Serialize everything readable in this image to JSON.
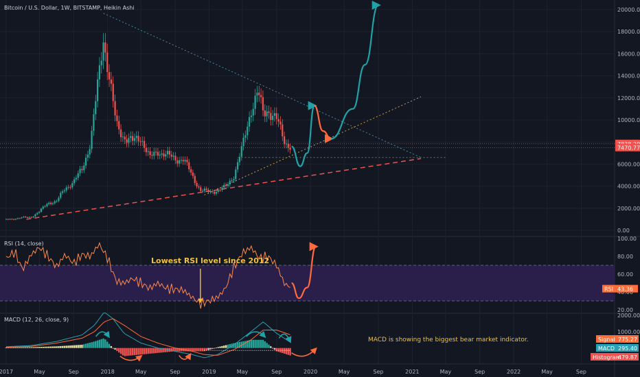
{
  "title": "Bitcoin / U.S. Dollar, 1W, BITSTAMP, Heikin Ashi",
  "colors": {
    "background": "#131722",
    "up": "#26a69a",
    "down": "#ef5350",
    "grid": "#1e2230",
    "rsi_band": "#2a1e4a",
    "rsi_line": "#ff8a4c",
    "macd_line": "#2aa1b5",
    "signal_line": "#ff6d3a",
    "annotation": "#f0c040",
    "teal_arrow": "#1fa3a8",
    "orange_arrow": "#ff6a3d"
  },
  "chart_data": [
    {
      "type": "candlestick",
      "title": "Bitcoin / U.S. Dollar, 1W, BITSTAMP, Heikin Ashi",
      "ylim": [
        0,
        20000
      ],
      "yticks": [
        "0.00",
        "2000.00",
        "4000.00",
        "6000.00",
        "8000.00",
        "10000.00",
        "12000.00",
        "14000.00",
        "16000.00",
        "18000.00",
        "20000.00"
      ],
      "price_labels": [
        {
          "text": "7838.20",
          "value": 7838.2,
          "color": "#ef5350"
        },
        {
          "text": "7470.77",
          "value": 7470.77,
          "color": "#ef5350"
        }
      ],
      "path": [
        [
          "2017-01-01",
          980
        ],
        [
          "2017-02-01",
          1050
        ],
        [
          "2017-03-01",
          1150
        ],
        [
          "2017-04-01",
          1200
        ],
        [
          "2017-05-01",
          1700
        ],
        [
          "2017-06-01",
          2500
        ],
        [
          "2017-07-01",
          2600
        ],
        [
          "2017-08-01",
          3800
        ],
        [
          "2017-09-01",
          4400
        ],
        [
          "2017-10-01",
          5500
        ],
        [
          "2017-11-01",
          8000
        ],
        [
          "2017-12-01",
          14000
        ],
        [
          "2017-12-17",
          17500
        ],
        [
          "2018-01-01",
          15000
        ],
        [
          "2018-02-01",
          9500
        ],
        [
          "2018-03-01",
          8500
        ],
        [
          "2018-04-01",
          8000
        ],
        [
          "2018-05-01",
          8500
        ],
        [
          "2018-06-01",
          6500
        ],
        [
          "2018-07-01",
          7200
        ],
        [
          "2018-08-01",
          6800
        ],
        [
          "2018-09-01",
          6500
        ],
        [
          "2018-10-01",
          6400
        ],
        [
          "2018-11-01",
          5000
        ],
        [
          "2018-12-01",
          3600
        ],
        [
          "2019-01-01",
          3500
        ],
        [
          "2019-02-01",
          3600
        ],
        [
          "2019-03-01",
          3900
        ],
        [
          "2019-04-01",
          5000
        ],
        [
          "2019-05-01",
          7500
        ],
        [
          "2019-06-01",
          11000
        ],
        [
          "2019-06-26",
          12500
        ],
        [
          "2019-07-15",
          10500
        ],
        [
          "2019-08-01",
          11000
        ],
        [
          "2019-09-01",
          10000
        ],
        [
          "2019-10-01",
          8000
        ],
        [
          "2019-10-25",
          7600
        ]
      ],
      "trendlines": [
        {
          "name": "descending resistance",
          "from": [
            "2017-12-17",
            19666
          ],
          "to": [
            "2021-02-01",
            6600
          ],
          "style": "dotted",
          "color": "#4a8aa0"
        },
        {
          "name": "ascending support",
          "from": [
            "2017-03-15",
            1000
          ],
          "to": [
            "2021-02-01",
            6500
          ],
          "style": "dashed",
          "color": "#ef5350"
        },
        {
          "name": "upper trend",
          "from": [
            "2018-12-15",
            3200
          ],
          "to": [
            "2021-02-01",
            12100
          ],
          "style": "dotted",
          "color": "#c8a04a"
        },
        {
          "name": "horizontal level",
          "from": [
            "2019-04-15",
            6600
          ],
          "to": [
            "2021-05-01",
            6600
          ],
          "style": "dotted",
          "color": "#6a7a5a"
        }
      ],
      "projection": [
        {
          "color": "#1fa3a8",
          "points": [
            [
              "2019-10-25",
              7600
            ],
            [
              "2019-11-25",
              5800
            ],
            [
              "2019-12-20",
              7000
            ],
            [
              "2020-01-15",
              11300
            ]
          ]
        },
        {
          "color": "#ff6a3d",
          "points": [
            [
              "2020-01-15",
              11300
            ],
            [
              "2020-02-15",
              9000
            ],
            [
              "2020-03-15",
              8300
            ]
          ]
        },
        {
          "color": "#1fa3a8",
          "points": [
            [
              "2020-03-15",
              8300
            ],
            [
              "2020-06-01",
              11000
            ],
            [
              "2020-07-15",
              15000
            ],
            [
              "2020-09-01",
              20400
            ]
          ]
        }
      ]
    },
    {
      "type": "line",
      "title": "RSI (14, close)",
      "ylim": [
        20,
        100
      ],
      "yticks": [
        "20.00",
        "40.00",
        "60.00",
        "80.00",
        "100.00"
      ],
      "band": [
        30,
        70
      ],
      "value_label": {
        "name": "RSI",
        "text": "43.36"
      },
      "series": [
        {
          "values": [
            [
              "2017-01-01",
              78
            ],
            [
              "2017-02-01",
              85
            ],
            [
              "2017-03-01",
              65
            ],
            [
              "2017-04-01",
              82
            ],
            [
              "2017-05-01",
              90
            ],
            [
              "2017-06-01",
              80
            ],
            [
              "2017-07-01",
              68
            ],
            [
              "2017-08-01",
              82
            ],
            [
              "2017-09-01",
              72
            ],
            [
              "2017-10-01",
              82
            ],
            [
              "2017-11-01",
              80
            ],
            [
              "2017-12-01",
              94
            ],
            [
              "2018-01-01",
              78
            ],
            [
              "2018-02-01",
              52
            ],
            [
              "2018-03-01",
              50
            ],
            [
              "2018-04-01",
              55
            ],
            [
              "2018-05-01",
              50
            ],
            [
              "2018-06-01",
              44
            ],
            [
              "2018-07-01",
              50
            ],
            [
              "2018-08-01",
              44
            ],
            [
              "2018-09-01",
              43
            ],
            [
              "2018-10-01",
              42
            ],
            [
              "2018-11-01",
              34
            ],
            [
              "2018-12-01",
              27
            ],
            [
              "2019-01-01",
              30
            ],
            [
              "2019-02-01",
              34
            ],
            [
              "2019-03-01",
              44
            ],
            [
              "2019-04-01",
              68
            ],
            [
              "2019-05-01",
              84
            ],
            [
              "2019-06-01",
              90
            ],
            [
              "2019-07-01",
              78
            ],
            [
              "2019-08-01",
              80
            ],
            [
              "2019-09-01",
              70
            ],
            [
              "2019-10-01",
              48
            ],
            [
              "2019-10-25",
              46
            ]
          ]
        }
      ],
      "projection": [
        [
          "2019-10-25",
          50
        ],
        [
          "2019-11-20",
          33
        ],
        [
          "2019-12-20",
          45
        ],
        [
          "2020-01-20",
          91
        ]
      ],
      "annotation": {
        "text": "Lowest RSI level since 2012",
        "arrow_to": [
          "2018-12-01",
          28
        ]
      }
    },
    {
      "type": "bar",
      "title": "MACD (12, 26, close, 9)",
      "ylim": [
        -600,
        2000
      ],
      "yticks": [
        "1000.00",
        "2000.00"
      ],
      "value_labels": [
        {
          "name": "Signal",
          "text": "775.27",
          "color": "#ff6d3a"
        },
        {
          "name": "MACD",
          "text": "295.40",
          "color": "#2aa1b5"
        },
        {
          "name": "Histogram",
          "text": "-479.87",
          "color": "#ef5350"
        }
      ],
      "macd": [
        [
          "2017-01-01",
          80
        ],
        [
          "2017-04-01",
          150
        ],
        [
          "2017-07-01",
          400
        ],
        [
          "2017-10-01",
          800
        ],
        [
          "2017-11-15",
          1400
        ],
        [
          "2017-12-20",
          2200
        ],
        [
          "2018-01-20",
          1800
        ],
        [
          "2018-03-01",
          900
        ],
        [
          "2018-05-01",
          300
        ],
        [
          "2018-07-01",
          0
        ],
        [
          "2018-09-01",
          -200
        ],
        [
          "2018-11-01",
          -400
        ],
        [
          "2018-12-15",
          -600
        ],
        [
          "2019-02-01",
          -400
        ],
        [
          "2019-04-01",
          200
        ],
        [
          "2019-06-01",
          1000
        ],
        [
          "2019-07-15",
          1600
        ],
        [
          "2019-09-01",
          900
        ],
        [
          "2019-10-25",
          300
        ]
      ],
      "signal": [
        [
          "2017-01-01",
          50
        ],
        [
          "2017-04-01",
          100
        ],
        [
          "2017-07-01",
          300
        ],
        [
          "2017-10-01",
          600
        ],
        [
          "2017-11-15",
          1000
        ],
        [
          "2017-12-20",
          1600
        ],
        [
          "2018-01-20",
          1800
        ],
        [
          "2018-03-01",
          1400
        ],
        [
          "2018-05-01",
          700
        ],
        [
          "2018-07-01",
          300
        ],
        [
          "2018-09-01",
          0
        ],
        [
          "2018-11-01",
          -200
        ],
        [
          "2018-12-15",
          -400
        ],
        [
          "2019-02-01",
          -450
        ],
        [
          "2019-04-01",
          -100
        ],
        [
          "2019-06-01",
          500
        ],
        [
          "2019-07-15",
          1100
        ],
        [
          "2019-09-01",
          1100
        ],
        [
          "2019-10-25",
          780
        ]
      ],
      "annotation": {
        "text": "MACD is showing the biggest bear market indicator."
      }
    }
  ],
  "x_axis": {
    "ticks": [
      {
        "label": "2017",
        "date": "2017-01-01"
      },
      {
        "label": "May",
        "date": "2017-05-01"
      },
      {
        "label": "Sep",
        "date": "2017-09-01"
      },
      {
        "label": "2018",
        "date": "2018-01-01"
      },
      {
        "label": "May",
        "date": "2018-05-01"
      },
      {
        "label": "Sep",
        "date": "2018-09-01"
      },
      {
        "label": "2019",
        "date": "2019-01-01"
      },
      {
        "label": "May",
        "date": "2019-05-01"
      },
      {
        "label": "Sep",
        "date": "2019-09-01"
      },
      {
        "label": "2020",
        "date": "2020-01-01"
      },
      {
        "label": "May",
        "date": "2020-05-01"
      },
      {
        "label": "Sep",
        "date": "2020-09-01"
      },
      {
        "label": "2021",
        "date": "2021-01-01"
      },
      {
        "label": "May",
        "date": "2021-05-01"
      },
      {
        "label": "Sep",
        "date": "2021-09-01"
      },
      {
        "label": "2022",
        "date": "2022-01-01"
      },
      {
        "label": "May",
        "date": "2022-05-01"
      },
      {
        "label": "Sep",
        "date": "2022-09-01"
      }
    ]
  }
}
